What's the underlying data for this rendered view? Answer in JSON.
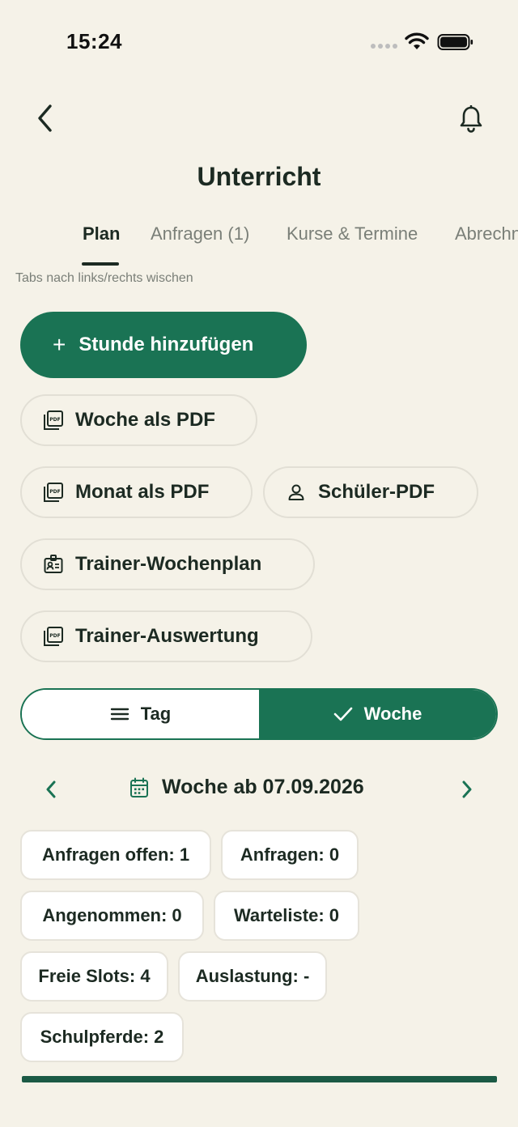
{
  "status": {
    "time": "15:24"
  },
  "header": {
    "title": "Unterricht"
  },
  "tabs": [
    {
      "label": "Plan"
    },
    {
      "label": "Anfragen (1)"
    },
    {
      "label": "Kurse & Termine"
    },
    {
      "label": "Abrechnung"
    }
  ],
  "tabs_hint": "Tabs nach links/rechts wischen",
  "actions": {
    "add_lesson": "Stunde hinzufügen",
    "week_pdf": "Woche als PDF",
    "month_pdf": "Monat als PDF",
    "student_pdf": "Schüler-PDF",
    "trainer_weekplan": "Trainer-Wochenplan",
    "trainer_evaluation": "Trainer-Auswertung"
  },
  "view_toggle": {
    "day": "Tag",
    "week": "Woche",
    "selected": "week"
  },
  "week_nav": {
    "label": "Woche ab 07.09.2026"
  },
  "stats": [
    {
      "label": "Anfragen offen: 1"
    },
    {
      "label": "Anfragen: 0"
    },
    {
      "label": "Angenommen: 0"
    },
    {
      "label": "Warteliste: 0"
    },
    {
      "label": "Freie Slots: 4"
    },
    {
      "label": "Auslastung: -"
    },
    {
      "label": "Schulpferde: 2"
    }
  ],
  "colors": {
    "accent": "#1a7354",
    "background": "#f5f2e8",
    "text": "#1c2a22"
  }
}
